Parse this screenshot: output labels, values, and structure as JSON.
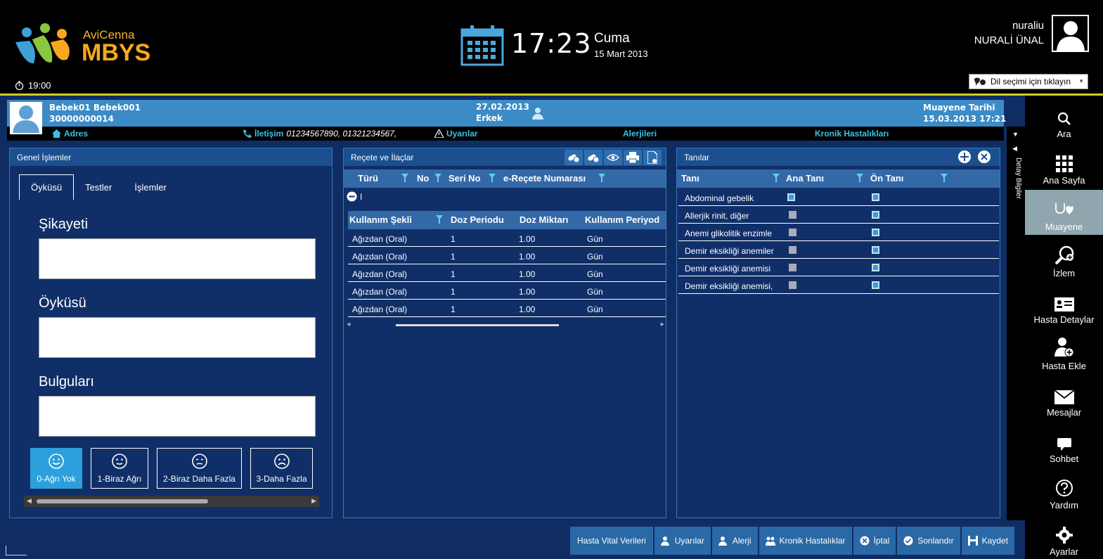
{
  "header": {
    "logo_sub": "AviCenna",
    "logo_main": "MBYS",
    "session_time": "19:00",
    "time": "17:23",
    "day": "Cuma",
    "date": "15 Mart 2013",
    "username": "nuraliu",
    "fullname": "NURALİ ÜNAL",
    "language_prompt": "Dil seçimi için tıklayın"
  },
  "patient": {
    "name": "Bebek01 Bebek001",
    "id": "30000000014",
    "birth_date": "27.02.2013",
    "gender": "Erkek",
    "exam_label": "Muayene Tarihi",
    "exam_date": "15.03.2013 17:21",
    "address_label": "Adres",
    "contact_label": "İletişim",
    "contact_value": "01234567890, 01321234567,",
    "warnings_label": "Uyarılar",
    "allergies_label": "Alerjileri",
    "chronic_label": "Kronik Hastalıkları"
  },
  "detay_label": "Detay Bilgiler",
  "sidebar": {
    "items": [
      {
        "label": "Ara",
        "icon": "search-icon"
      },
      {
        "label": "Ana Sayfa",
        "icon": "grid-icon"
      },
      {
        "label": "Muayene",
        "icon": "stethoscope-icon"
      },
      {
        "label": "İzlem",
        "icon": "zoom-plus-icon"
      },
      {
        "label": "Hasta Detaylar",
        "icon": "id-card-icon"
      },
      {
        "label": "Hasta Ekle",
        "icon": "user-add-icon"
      },
      {
        "label": "Mesajlar",
        "icon": "mail-icon"
      },
      {
        "label": "Sohbet",
        "icon": "chat-icon"
      },
      {
        "label": "Yardım",
        "icon": "help-icon"
      },
      {
        "label": "Ayarlar",
        "icon": "gear-icon"
      }
    ]
  },
  "genel": {
    "title": "Genel İşlemler",
    "tabs": [
      "Öyküsü",
      "Testler",
      "İşlemler"
    ],
    "fields": [
      "Şikayeti",
      "Öyküsü",
      "Bulguları"
    ],
    "pain_levels": [
      "0-Ağrı Yok",
      "1-Biraz Ağrı",
      "2-Biraz Daha Fazla",
      "3-Daha Fazla"
    ]
  },
  "recete": {
    "title": "Reçete ve İlaçlar",
    "columns": [
      "Türü",
      "No",
      "Seri No",
      "e-Reçete Numarası"
    ],
    "expand_text": "I",
    "sub_columns": [
      "Kullanım Şekli",
      "Doz Periodu",
      "Doz Miktarı",
      "Kullanım Periyod"
    ],
    "rows": [
      [
        "Ağızdan (Oral)",
        "1",
        "1.00",
        "Gün"
      ],
      [
        "Ağızdan (Oral)",
        "1",
        "1.00",
        "Gün"
      ],
      [
        "Ağızdan (Oral)",
        "1",
        "1.00",
        "Gün"
      ],
      [
        "Ağızdan (Oral)",
        "1",
        "1.00",
        "Gün"
      ],
      [
        "Ağızdan (Oral)",
        "1",
        "1.00",
        "Gün"
      ]
    ]
  },
  "tanilar": {
    "title": "Tanılar",
    "columns": [
      "Tanı",
      "Ana Tanı",
      "Ön Tanı"
    ],
    "rows": [
      {
        "name": "Abdominal gebelik",
        "ana": true,
        "on": true
      },
      {
        "name": "Allerjik rinit, diğer",
        "ana": false,
        "on": true
      },
      {
        "name": "Anemi glikolitik enzimle",
        "ana": false,
        "on": true
      },
      {
        "name": "Demir eksikliği anemiler",
        "ana": false,
        "on": true
      },
      {
        "name": "Demir eksikliği anemisi",
        "ana": false,
        "on": true
      },
      {
        "name": "Demir eksikliği anemisi,",
        "ana": false,
        "on": true
      }
    ]
  },
  "bottom_buttons": [
    "Hasta Vital Verileri",
    "Uyarılar",
    "Alerji",
    "Kronik Hastalıklar",
    "İptal",
    "Sonlandır",
    "Kaydet"
  ]
}
